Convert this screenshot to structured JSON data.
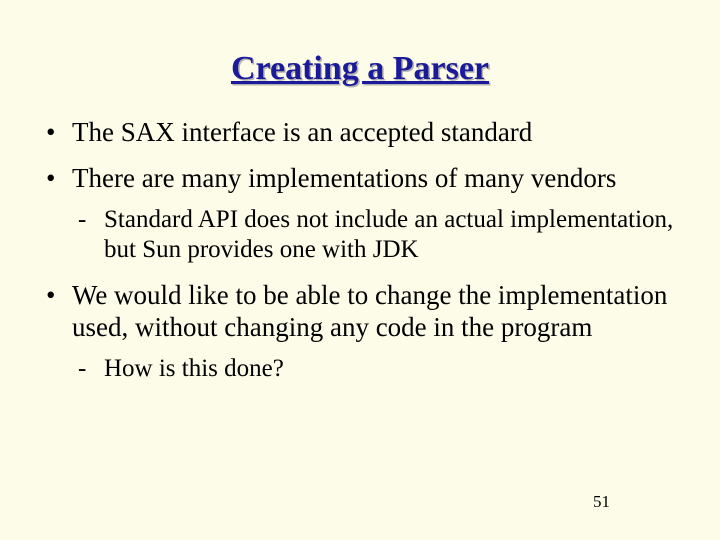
{
  "title": "Creating a Parser",
  "bullets": [
    {
      "text": "The SAX interface is an accepted standard",
      "sub": []
    },
    {
      "text": "There are many implementations of many vendors",
      "sub": [
        "Standard API does not include an actual implementation, but Sun provides one with JDK"
      ]
    },
    {
      "text": "We would like to be able to change the implementation used, without changing any code in the program",
      "sub": [
        "How is this done?"
      ]
    }
  ],
  "page_number": "51"
}
